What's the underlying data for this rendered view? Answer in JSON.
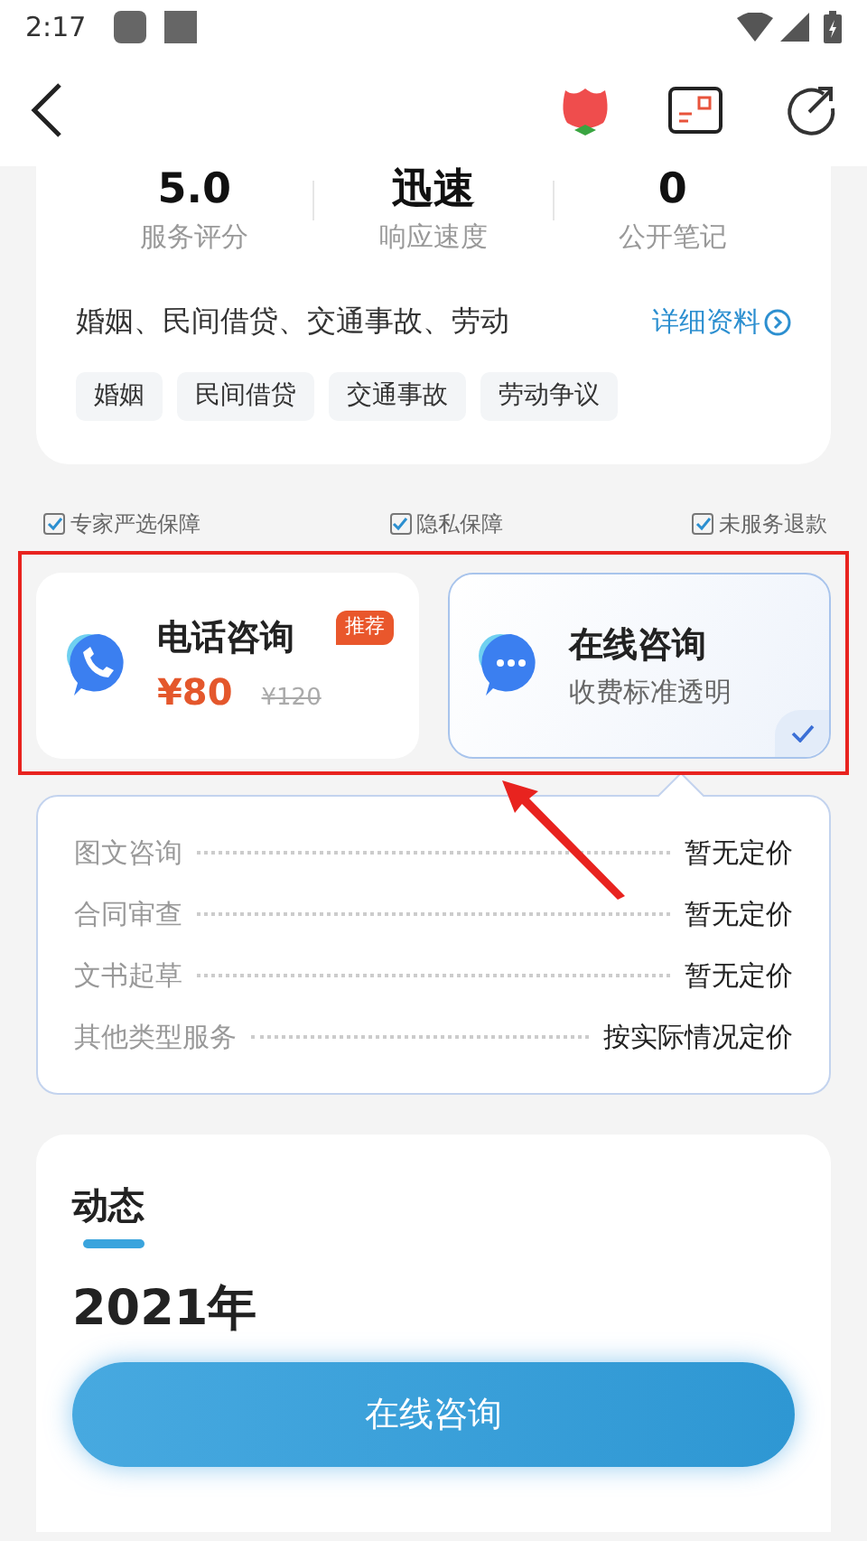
{
  "status_bar": {
    "time": "2:17"
  },
  "stats": [
    {
      "value": "5.0",
      "label": "服务评分"
    },
    {
      "value": "迅速",
      "label": "响应速度"
    },
    {
      "value": "0",
      "label": "公开笔记"
    }
  ],
  "fields_line": "婚姻、民间借贷、交通事故、劳动",
  "details_link": "详细资料",
  "tags": [
    "婚姻",
    "民间借贷",
    "交通事故",
    "劳动争议"
  ],
  "guarantees": [
    {
      "label": "专家严选保障",
      "checked": true
    },
    {
      "label": "隐私保障",
      "checked": true
    },
    {
      "label": "未服务退款",
      "checked": true
    }
  ],
  "consult_options": [
    {
      "kind": "phone",
      "title": "电话咨询",
      "badge": "推荐",
      "price": "¥80",
      "original_price": "¥120",
      "selected": false
    },
    {
      "kind": "chat",
      "title": "在线咨询",
      "subtitle": "收费标准透明",
      "selected": true
    }
  ],
  "price_list": [
    {
      "service": "图文咨询",
      "price": "暂无定价"
    },
    {
      "service": "合同审查",
      "price": "暂无定价"
    },
    {
      "service": "文书起草",
      "price": "暂无定价"
    },
    {
      "service": "其他类型服务",
      "price": "按实际情况定价"
    }
  ],
  "feed": {
    "title": "动态",
    "year": "2021年"
  },
  "action_button": "在线咨询"
}
